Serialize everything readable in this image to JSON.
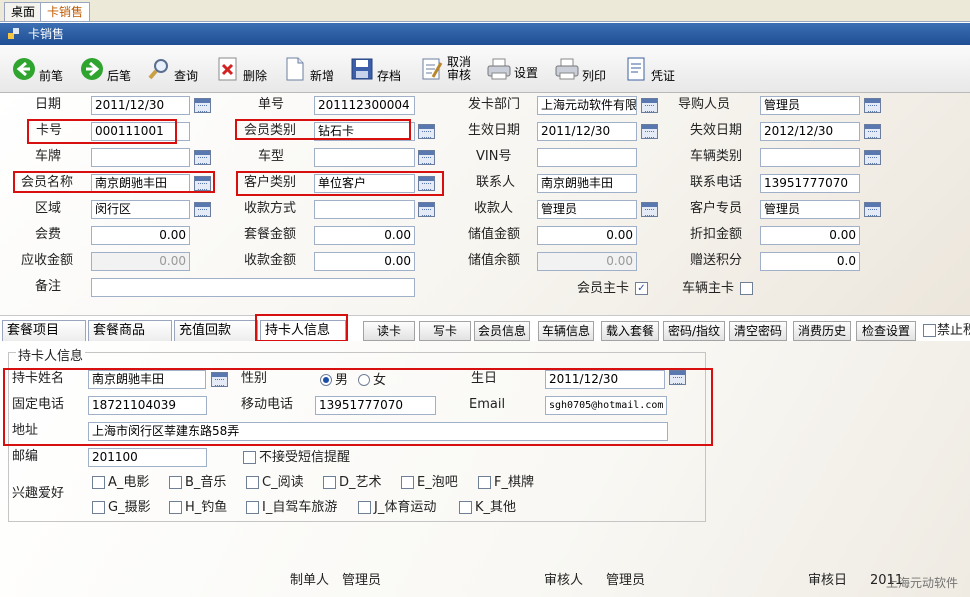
{
  "top_tabs": [
    "桌面",
    "卡销售"
  ],
  "window_title": "卡销售",
  "toolbar": [
    {
      "label": "前笔",
      "icon": "back-arrow-icon"
    },
    {
      "label": "后笔",
      "icon": "forward-arrow-icon"
    },
    {
      "label": "查询",
      "icon": "magnifier-icon"
    },
    {
      "label": "删除",
      "icon": "delete-icon"
    },
    {
      "label": "新增",
      "icon": "new-page-icon"
    },
    {
      "label": "存档",
      "icon": "save-disk-icon"
    },
    {
      "label": "取消",
      "label2": "审核",
      "icon": "cancel-audit-icon"
    },
    {
      "label": "设置",
      "icon": "printer-settings-icon"
    },
    {
      "label": "列印",
      "icon": "printer-icon"
    },
    {
      "label": "凭证",
      "icon": "voucher-icon"
    }
  ],
  "form": {
    "date": {
      "label": "日期",
      "value": "2011/12/30"
    },
    "doc_no": {
      "label": "单号",
      "value": "201112300004"
    },
    "issue_dept": {
      "label": "发卡部门",
      "value": "上海元动软件有限"
    },
    "buyer": {
      "label": "导购人员",
      "value": "管理员"
    },
    "card_no": {
      "label": "卡号",
      "value": "000111001"
    },
    "member_type": {
      "label": "会员类别",
      "value": "钻石卡"
    },
    "effective_date": {
      "label": "生效日期",
      "value": "2011/12/30"
    },
    "expire_date": {
      "label": "失效日期",
      "value": "2012/12/30"
    },
    "plate": {
      "label": "车牌",
      "value": ""
    },
    "car_model": {
      "label": "车型",
      "value": ""
    },
    "vin": {
      "label": "VIN号",
      "value": ""
    },
    "vehicle_type": {
      "label": "车辆类别",
      "value": ""
    },
    "member_name": {
      "label": "会员名称",
      "value": "南京朗驰丰田"
    },
    "customer_type": {
      "label": "客户类别",
      "value": "单位客户"
    },
    "contact": {
      "label": "联系人",
      "value": "南京朗驰丰田"
    },
    "contact_phone": {
      "label": "联系电话",
      "value": "13951777070"
    },
    "region": {
      "label": "区域",
      "value": "闵行区"
    },
    "pay_method": {
      "label": "收款方式",
      "value": ""
    },
    "payee": {
      "label": "收款人",
      "value": "管理员"
    },
    "customer_rep": {
      "label": "客户专员",
      "value": "管理员"
    },
    "fee": {
      "label": "会费",
      "value": "0.00"
    },
    "package_amount": {
      "label": "套餐金额",
      "value": "0.00"
    },
    "stored_amount": {
      "label": "储值金额",
      "value": "0.00"
    },
    "discount_amount": {
      "label": "折扣金额",
      "value": "0.00"
    },
    "receivable": {
      "label": "应收金额",
      "value": "0.00"
    },
    "received": {
      "label": "收款金额",
      "value": "0.00"
    },
    "stored_balance": {
      "label": "储值余额",
      "value": "0.00"
    },
    "gift_points": {
      "label": "赠送积分",
      "value": "0.0"
    },
    "remark": {
      "label": "备注",
      "value": ""
    },
    "member_main_card": {
      "label": "会员主卡",
      "checked": true
    },
    "vehicle_main_card": {
      "label": "车辆主卡",
      "checked": false
    }
  },
  "tabs": [
    "套餐项目",
    "套餐商品",
    "充值回款",
    "持卡人信息"
  ],
  "action_buttons": [
    "读卡",
    "写卡",
    "会员信息",
    "车辆信息",
    "载入套餐",
    "密码/指纹",
    "清空密码",
    "消费历史",
    "检查设置"
  ],
  "no_points_checkbox": {
    "label": "禁止积",
    "checked": false
  },
  "holder": {
    "group_title": "持卡人信息",
    "name": {
      "label": "持卡姓名",
      "value": "南京朗驰丰田"
    },
    "gender": {
      "label": "性别",
      "options": [
        "男",
        "女"
      ],
      "selected": "男"
    },
    "birthday": {
      "label": "生日",
      "value": "2011/12/30"
    },
    "phone": {
      "label": "固定电话",
      "value": "18721104039"
    },
    "mobile": {
      "label": "移动电话",
      "value": "13951777070"
    },
    "email": {
      "label": "Email",
      "value": "sgh0705@hotmail.com"
    },
    "address": {
      "label": "地址",
      "value": "上海市闵行区莘建东路58弄"
    },
    "zip": {
      "label": "邮编",
      "value": "201100"
    },
    "no_sms": {
      "label": "不接受短信提醒",
      "checked": false
    },
    "hobby_label": "兴趣爱好",
    "hobbies": [
      "A_电影",
      "B_音乐",
      "C_阅读",
      "D_艺术",
      "E_泡吧",
      "F_棋牌",
      "G_摄影",
      "H_钓鱼",
      "I_自驾车旅游",
      "J_体育运动",
      "K_其他"
    ]
  },
  "footer": {
    "maker_label": "制单人",
    "maker": "管理员",
    "auditor_label": "审核人",
    "auditor": "管理员",
    "audit_date_label": "审核日",
    "audit_date": "2011",
    "watermark": "上海元动软件"
  },
  "colors": {
    "highlight_red": "#d80f0f",
    "title_blue": "#1f4e94",
    "top_tab_active": "#c05a00"
  }
}
